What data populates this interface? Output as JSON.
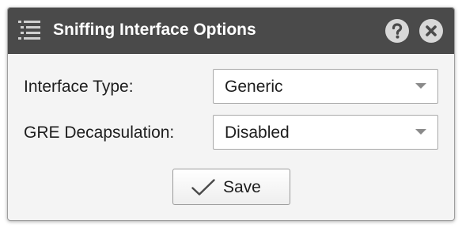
{
  "dialog": {
    "title": "Sniffing Interface Options",
    "title_icon": "list-icon",
    "help_icon": "help-icon",
    "close_icon": "close-icon"
  },
  "form": {
    "interface_type": {
      "label": "Interface Type:",
      "value": "Generic"
    },
    "gre_decapsulation": {
      "label": "GRE Decapsulation:",
      "value": "Disabled"
    }
  },
  "actions": {
    "save_label": "Save",
    "save_icon": "check-icon"
  },
  "colors": {
    "titlebar": "#4a4a4a",
    "dialog_bg": "#f4f4f4",
    "text": "#1e1e1e"
  }
}
